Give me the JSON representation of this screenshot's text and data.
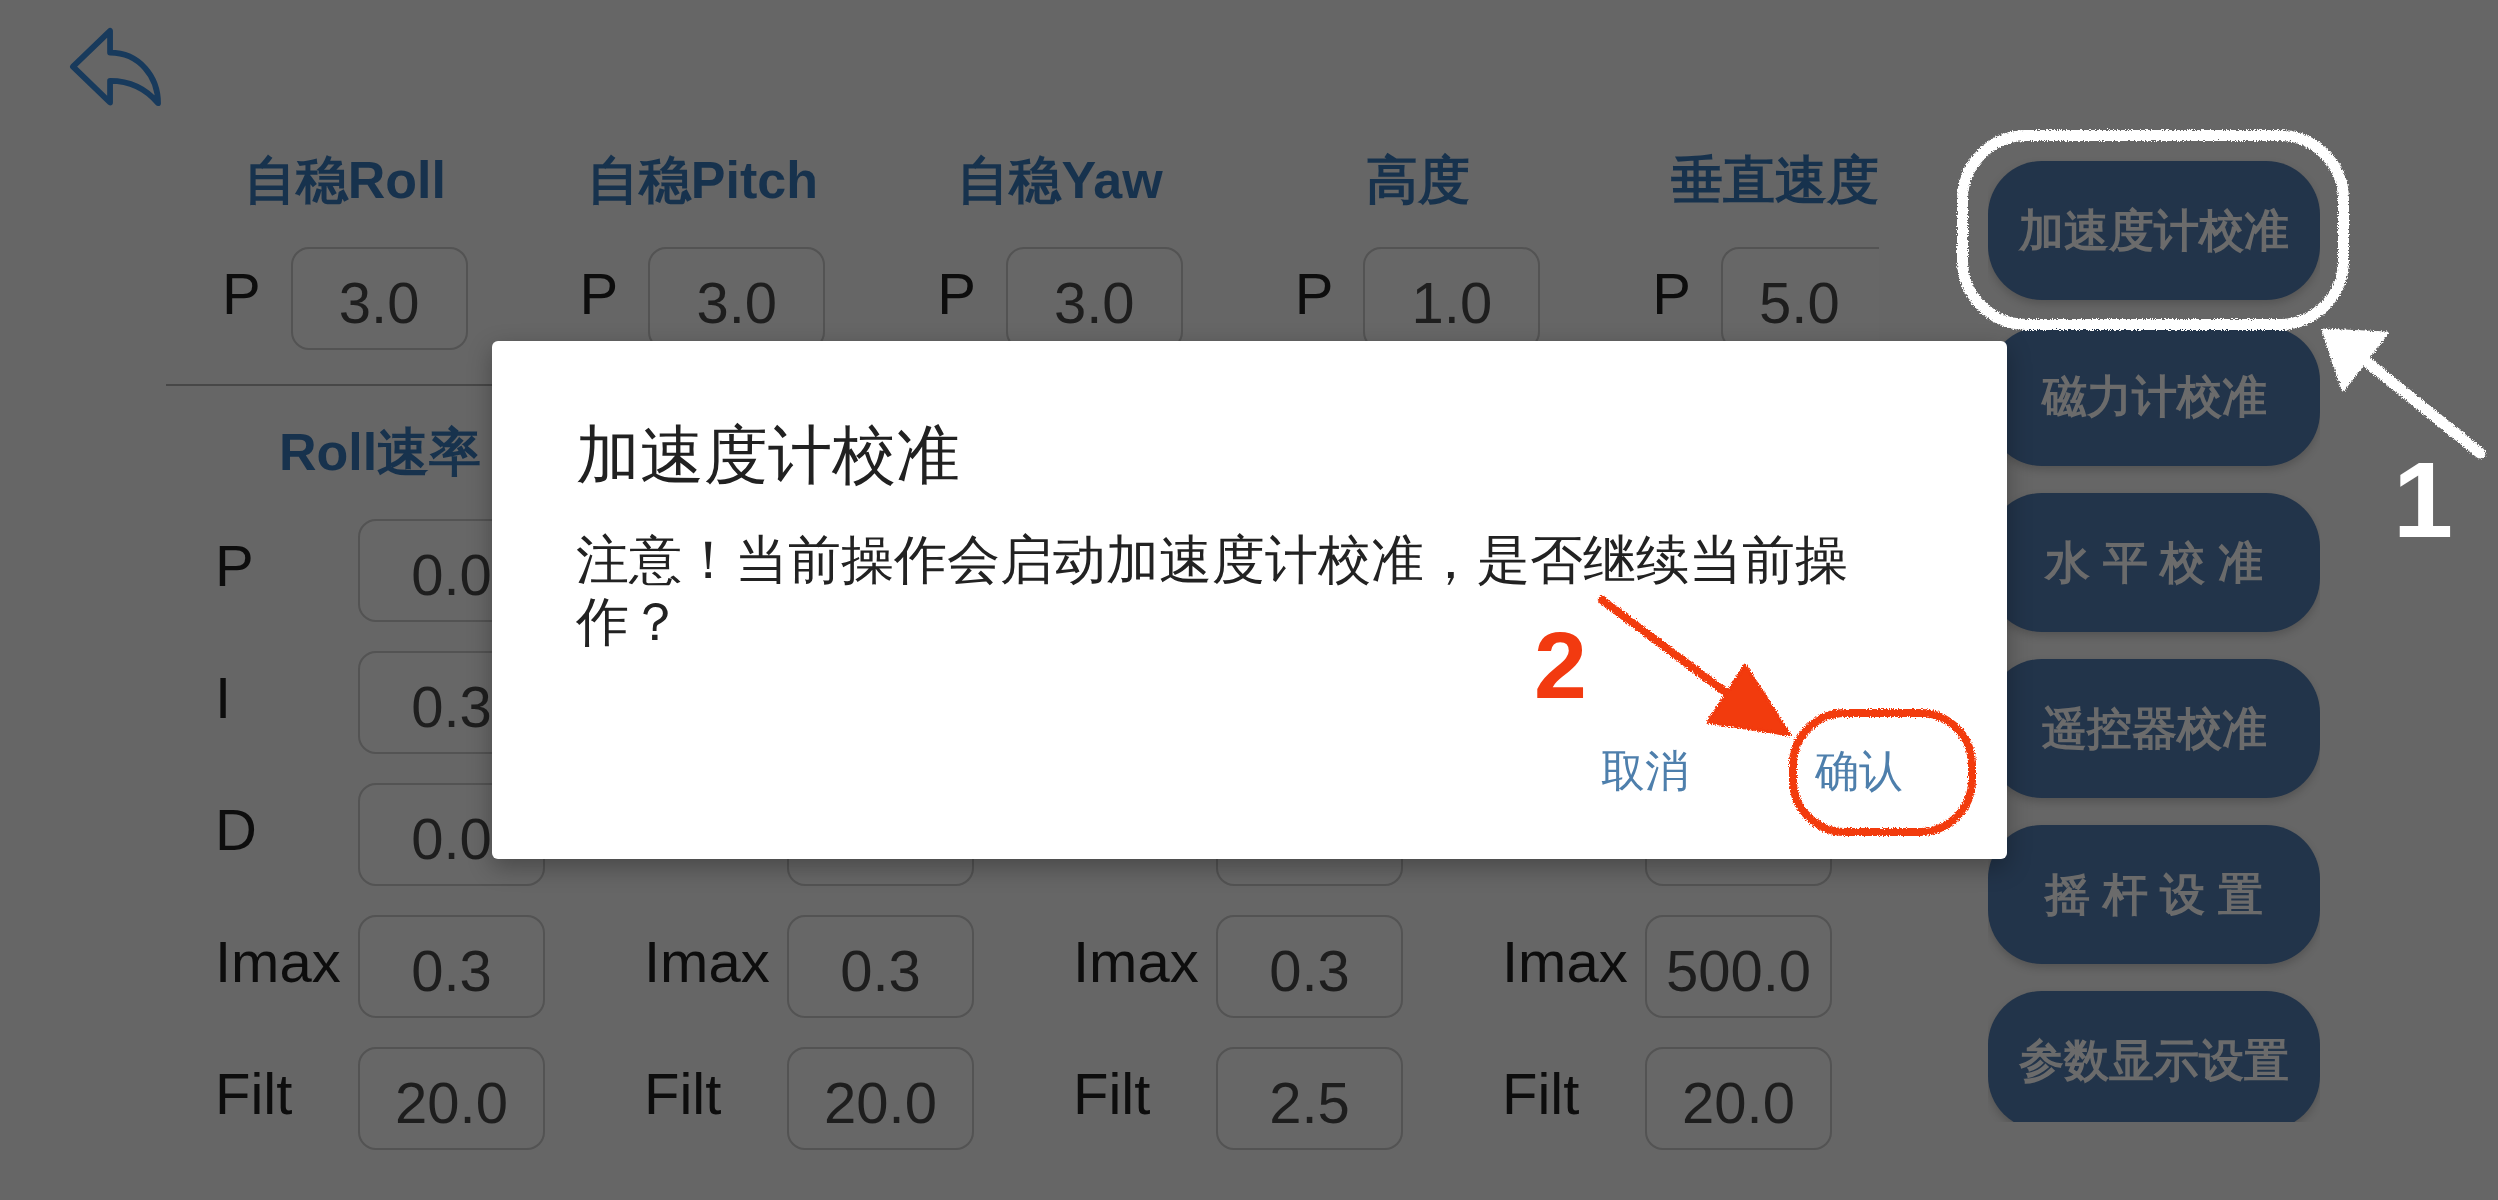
{
  "attitude_columns": [
    {
      "heading": "自稳Roll",
      "label": "P",
      "value": "3.0"
    },
    {
      "heading": "自稳Pitch",
      "label": "P",
      "value": "3.0"
    },
    {
      "heading": "自稳Yaw",
      "label": "P",
      "value": "3.0"
    },
    {
      "heading": "高度",
      "label": "P",
      "value": "1.0"
    },
    {
      "heading": "垂直速度",
      "label": "P",
      "value": "5.0"
    }
  ],
  "rate_columns": [
    {
      "heading": "Roll速率",
      "rows": [
        {
          "kind": "param",
          "label": "P",
          "value": "0.0"
        },
        {
          "kind": "param",
          "label": "I",
          "value": "0.3"
        },
        {
          "kind": "param",
          "label": "D",
          "value": "0.0"
        },
        {
          "kind": "param",
          "label": "Imax",
          "value": "0.3"
        },
        {
          "kind": "param",
          "label": "Filt",
          "value": "20.0"
        }
      ]
    },
    {
      "rows": [
        {
          "kind": "field_edge"
        },
        {
          "kind": "param",
          "label": "Imax",
          "value": "0.3"
        },
        {
          "kind": "param",
          "label": "Filt",
          "value": "20.0"
        }
      ]
    },
    {
      "rows": [
        {
          "kind": "field_edge"
        },
        {
          "kind": "param",
          "label": "Imax",
          "value": "0.3"
        },
        {
          "kind": "param",
          "label": "Filt",
          "value": "2.5"
        }
      ]
    },
    {
      "rows": [
        {
          "kind": "field_edge"
        },
        {
          "kind": "param",
          "label": "Imax",
          "value": "500.0"
        },
        {
          "kind": "param",
          "label": "Filt",
          "value": "20.0"
        }
      ]
    }
  ],
  "side_buttons": [
    "加速度计校准",
    "磁力计校准",
    "水 平 校 准",
    "遥控器校准",
    "摇 杆 设 置",
    "参数显示设置"
  ],
  "dialog": {
    "title": "加速度计校准",
    "message": "注意！当前操作会启动加速度计校准，是否继续当前操作？",
    "buttons": [
      "取消",
      "确认"
    ]
  },
  "annotations": [
    {
      "label": "1",
      "color": "#ffffff"
    },
    {
      "label": "2",
      "color": "#f23a10"
    }
  ]
}
